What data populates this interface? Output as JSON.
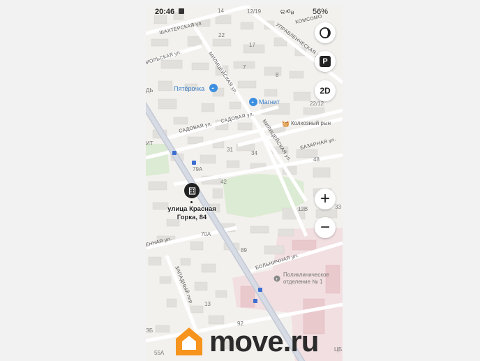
{
  "status_bar": {
    "time": "20:46",
    "signal": "ଳ ⁴ᴳ ᵢₗ ᵢₗ",
    "battery": "56%"
  },
  "map": {
    "streets": [
      "ШАХТЕРСКАЯ ул.",
      "КОМСОМО",
      "УПРАВЛЕНЧЕСКАЯ ул.",
      "МОЛЬСКАЯ ул.",
      "МИЛИЦЕЙСКАЯ ул.",
      "МИЛИЦЕЙСКАЯ ул.",
      "САДОВАЯ ул.",
      "САДОВАЯ ул.",
      "БАЗАРНАЯ ул.",
      "ЕННАЯ ул.",
      "ЗАПАДНЫЙ пер.",
      "БОЛЬНИЧНАЯ ул."
    ],
    "pois": [
      "Пятёрочка",
      "Магнит",
      "Колхозный рын",
      "Поликлиническое отделение № 1"
    ],
    "house_numbers": [
      "14",
      "12/19",
      "22",
      "17",
      "7",
      "8",
      "22/12",
      "31",
      "34",
      "48",
      "79А",
      "42",
      "12В",
      "33",
      "70А",
      "89",
      "13",
      "92",
      "55А",
      "ЗБ",
      "ЦБ",
      "ДЬ",
      "ИТ"
    ],
    "selected_address": "улица Красная Горка, 84"
  },
  "controls": {
    "p_label": "P",
    "mode_label": "2D",
    "zoom_in": "+",
    "zoom_out": "−"
  },
  "watermark": {
    "brand": "move.ru",
    "brand_color": "#f7941d",
    "text_color": "#2b2b2b"
  }
}
